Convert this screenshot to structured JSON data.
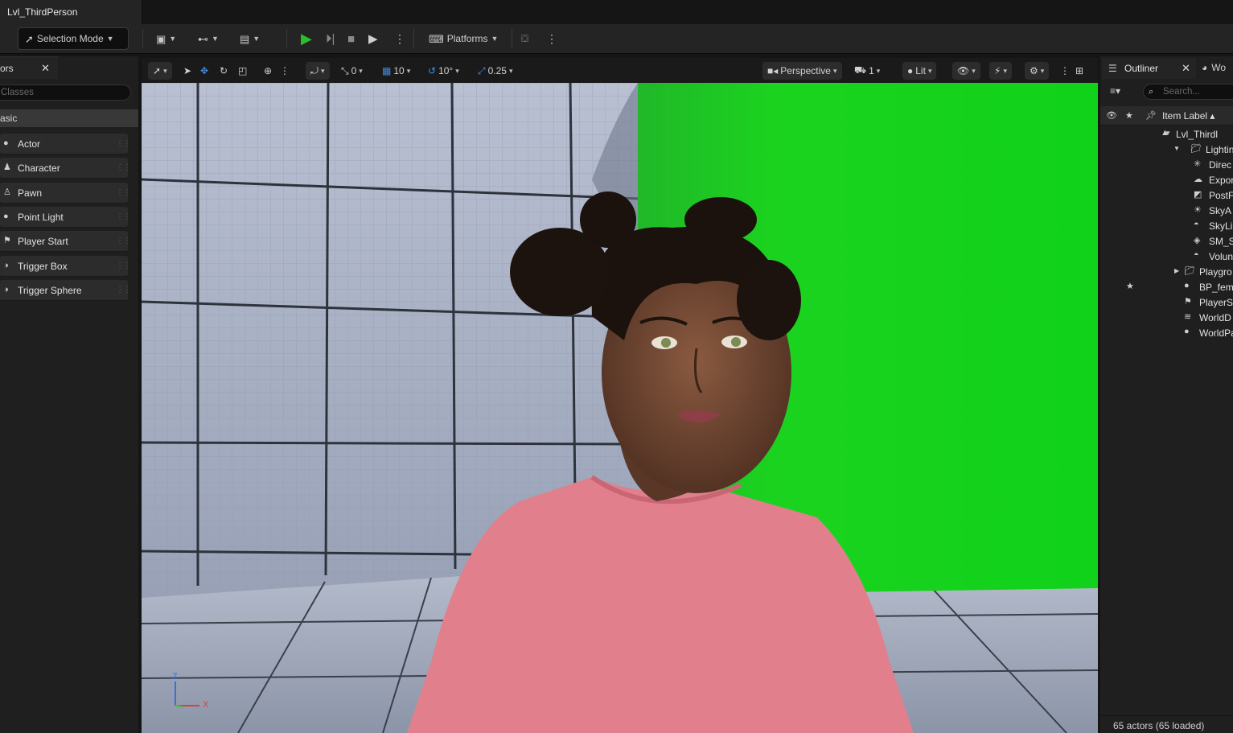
{
  "window": {
    "level_tab": "Lvl_ThirdPerson"
  },
  "main_toolbar": {
    "selection_mode": "Selection Mode",
    "platforms": "Platforms"
  },
  "place_actors": {
    "tab_label": "ors",
    "search_placeholder": "Classes",
    "category": "asic",
    "items": [
      {
        "label": "Actor",
        "icon": "sphere-icon"
      },
      {
        "label": "Character",
        "icon": "character-icon"
      },
      {
        "label": "Pawn",
        "icon": "pawn-icon"
      },
      {
        "label": "Point Light",
        "icon": "light-bulb-icon"
      },
      {
        "label": "Player Start",
        "icon": "player-start-icon"
      },
      {
        "label": "Trigger Box",
        "icon": "trigger-box-icon"
      },
      {
        "label": "Trigger Sphere",
        "icon": "trigger-sphere-icon"
      }
    ]
  },
  "viewport_toolbar": {
    "translate_snap": "0",
    "grid_snap": "10",
    "rotate_snap": "10°",
    "scale_snap": "0.25",
    "view_mode": "Perspective",
    "camera_speed": "1",
    "lighting_mode": "Lit"
  },
  "gizmo": {
    "z": "Z",
    "x": "X"
  },
  "outliner": {
    "tab_label": "Outliner",
    "second_tab": "Wo",
    "search_placeholder": "Search...",
    "column_label": "Item Label",
    "rows": [
      {
        "label": "Lvl_Thirdl"
      },
      {
        "label": "Lighting"
      },
      {
        "label": "Direc"
      },
      {
        "label": "Expor"
      },
      {
        "label": "PostF"
      },
      {
        "label": "SkyA"
      },
      {
        "label": "SkyLi"
      },
      {
        "label": "SM_S"
      },
      {
        "label": "Volun"
      },
      {
        "label": "Playgro"
      },
      {
        "label": "BP_fem"
      },
      {
        "label": "PlayerS"
      },
      {
        "label": "WorldD"
      },
      {
        "label": "WorldPa"
      }
    ],
    "status": "65 actors (65 loaded)"
  },
  "colors": {
    "accent_blue": "#3d8ee6",
    "play_green": "#2cbf2c",
    "chroma_green": "#19d719",
    "shirt_pink": "#e27f8c"
  }
}
